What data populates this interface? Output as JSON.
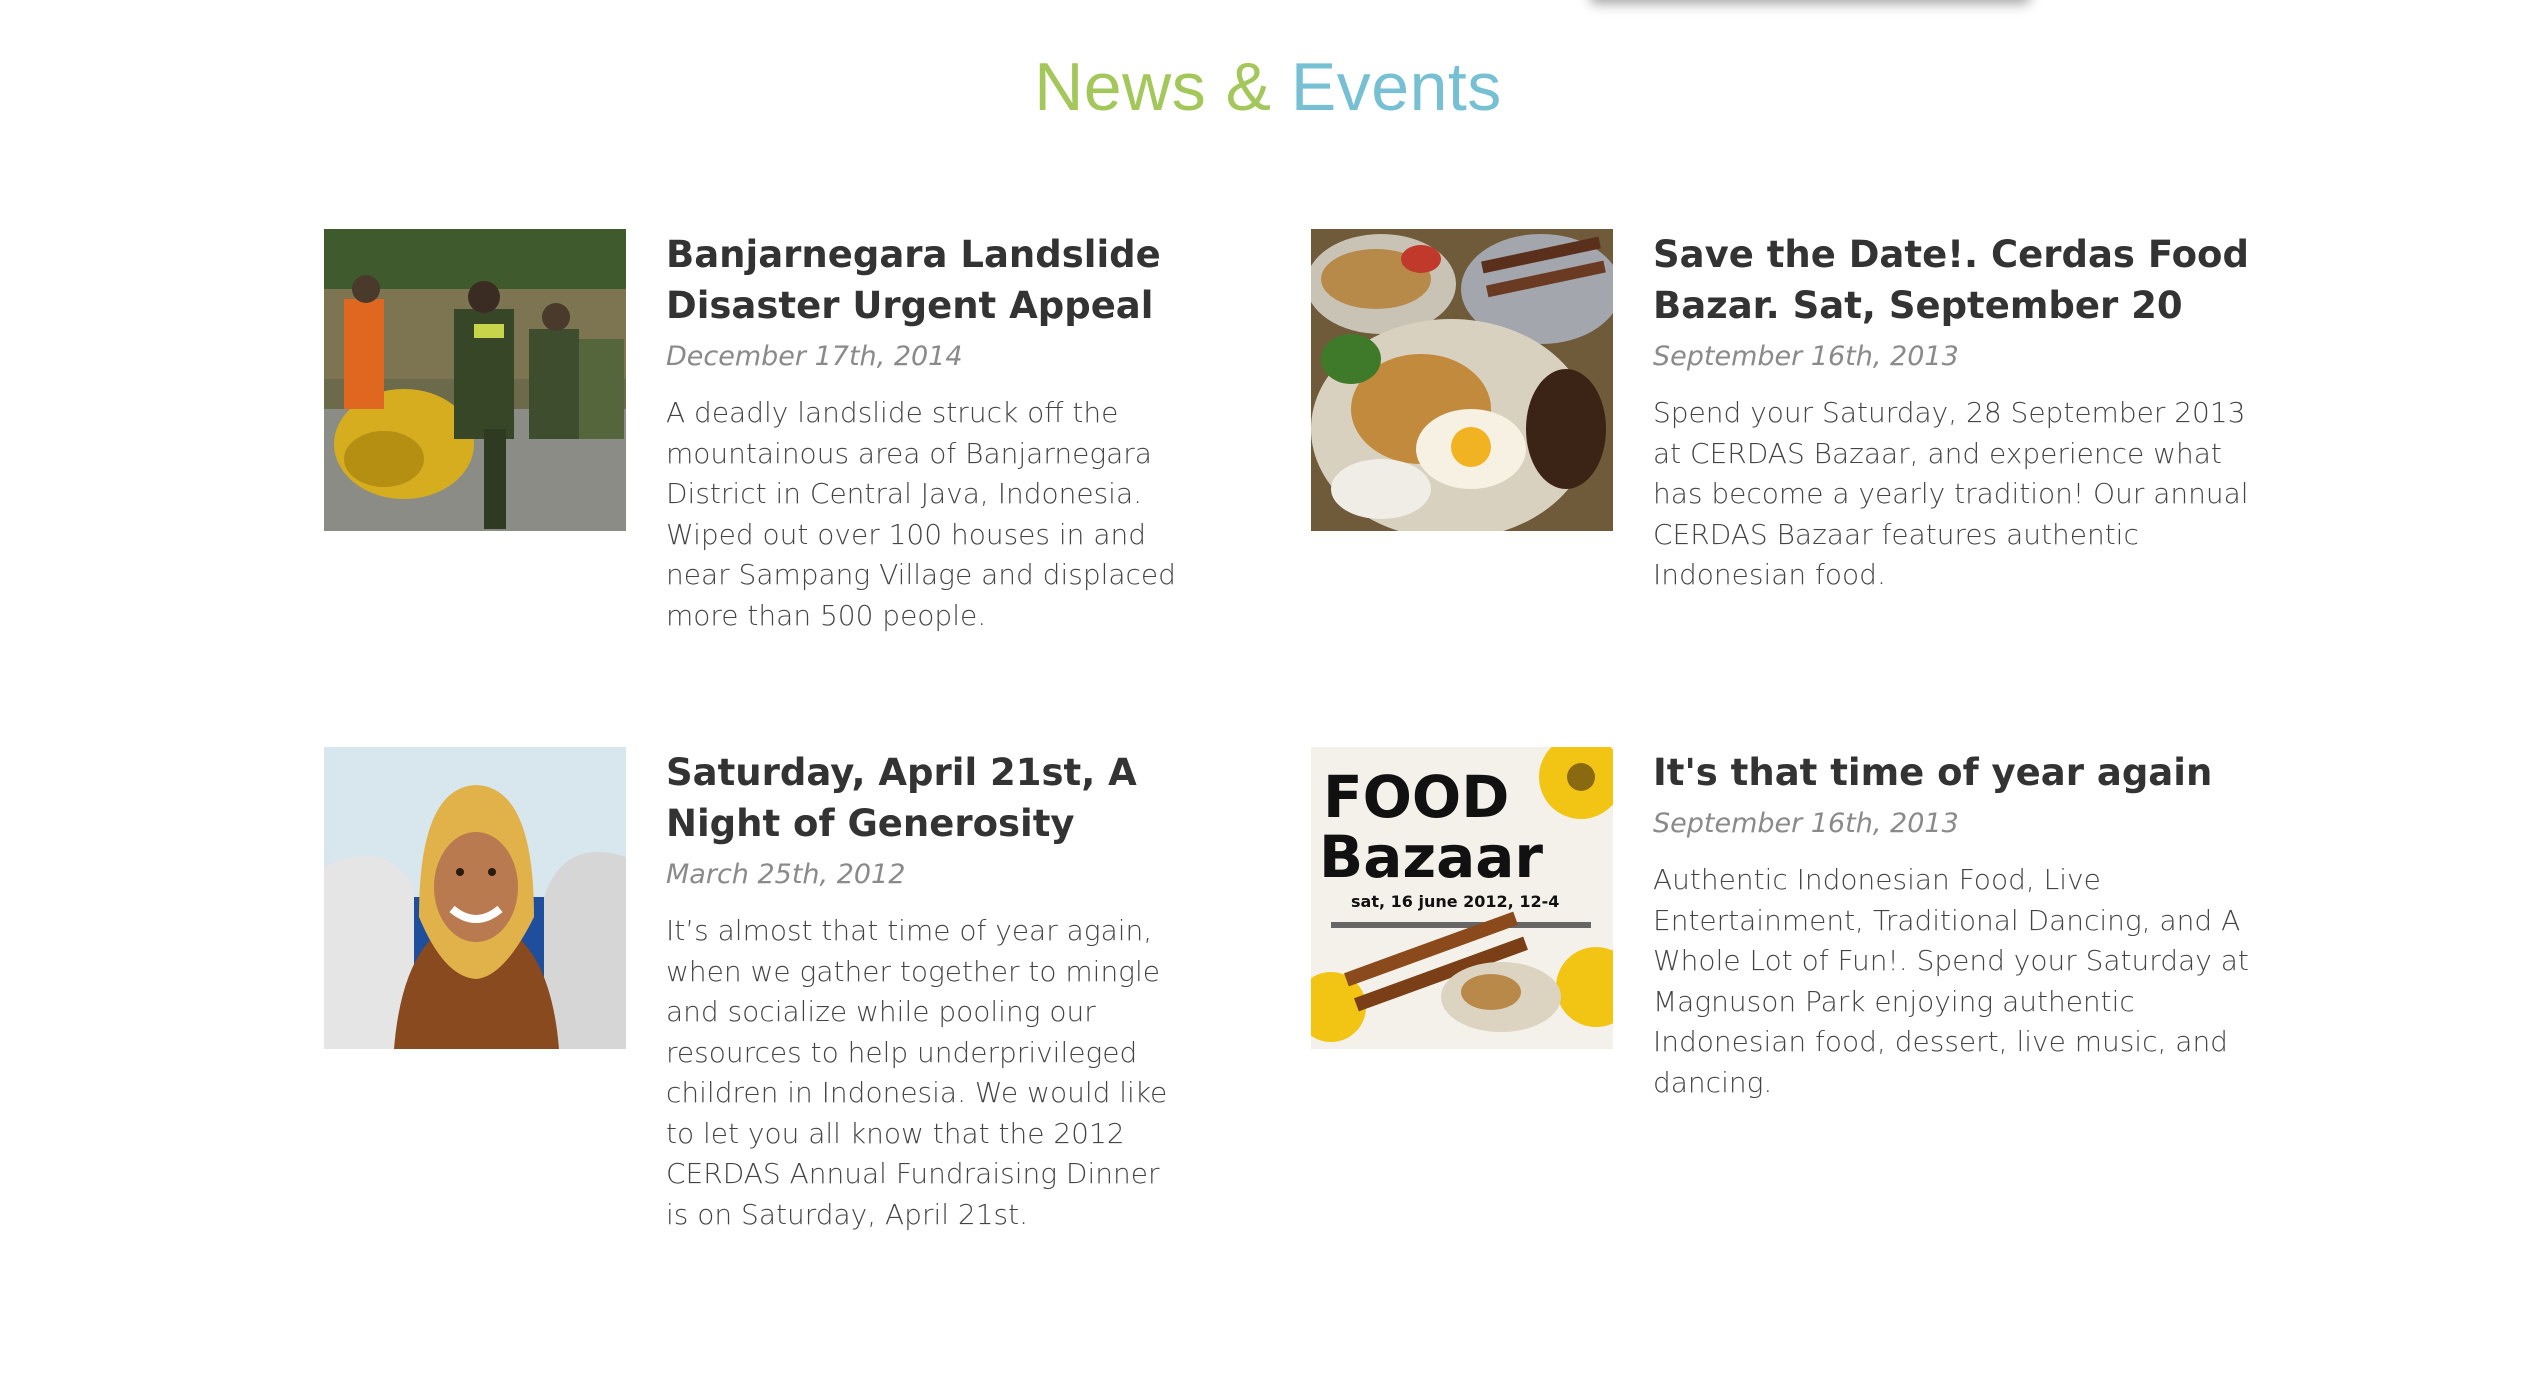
{
  "section": {
    "title_part1": "News",
    "title_amp": "&",
    "title_part2": "Events"
  },
  "articles": [
    {
      "title": "Banjarnegara Landslide Disaster Urgent Appeal",
      "date": "December 17th, 2014",
      "summary": "A deadly landslide struck off the mountainous area of Banjarnegara District in Central Java, Indonesia. Wiped out over 100 houses in and near Sampang Village and displaced more than 500 people."
    },
    {
      "title": "Save the Date!. Cerdas Food Bazar. Sat, September 20",
      "date": "September 16th, 2013",
      "summary": "Spend your Saturday, 28 September 2013 at CERDAS Bazaar, and experience what has become a yearly tradition! Our annual CERDAS Bazaar features authentic Indonesian food."
    },
    {
      "title": "Saturday, April 21st, A Night of Generosity",
      "date": "March 25th, 2012",
      "summary": "It’s almost that time of year again, when we gather together to mingle and socialize while pooling our resources to help underprivileged children in Indonesia. We would like to let you all know that the 2012 CERDAS Annual Fundraising Dinner is on Saturday, April 21st."
    },
    {
      "title": "It's that time of year again",
      "date": "September 16th, 2013",
      "summary": "Authentic Indonesian Food, Live Entertainment, Traditional Dancing, and A Whole Lot of Fun!. Spend your Saturday at Magnuson Park enjoying authentic Indonesian food, dessert, live music, and dancing."
    }
  ],
  "poster": {
    "line1": "FOOD",
    "line2": "Bazaar",
    "line3": "sat, 16 june 2012, 12-4"
  },
  "colors": {
    "title_green": "#a3c75a",
    "title_blue": "#77c0d3",
    "headline": "#333333",
    "date": "#8a8a8a",
    "body": "#444444"
  }
}
